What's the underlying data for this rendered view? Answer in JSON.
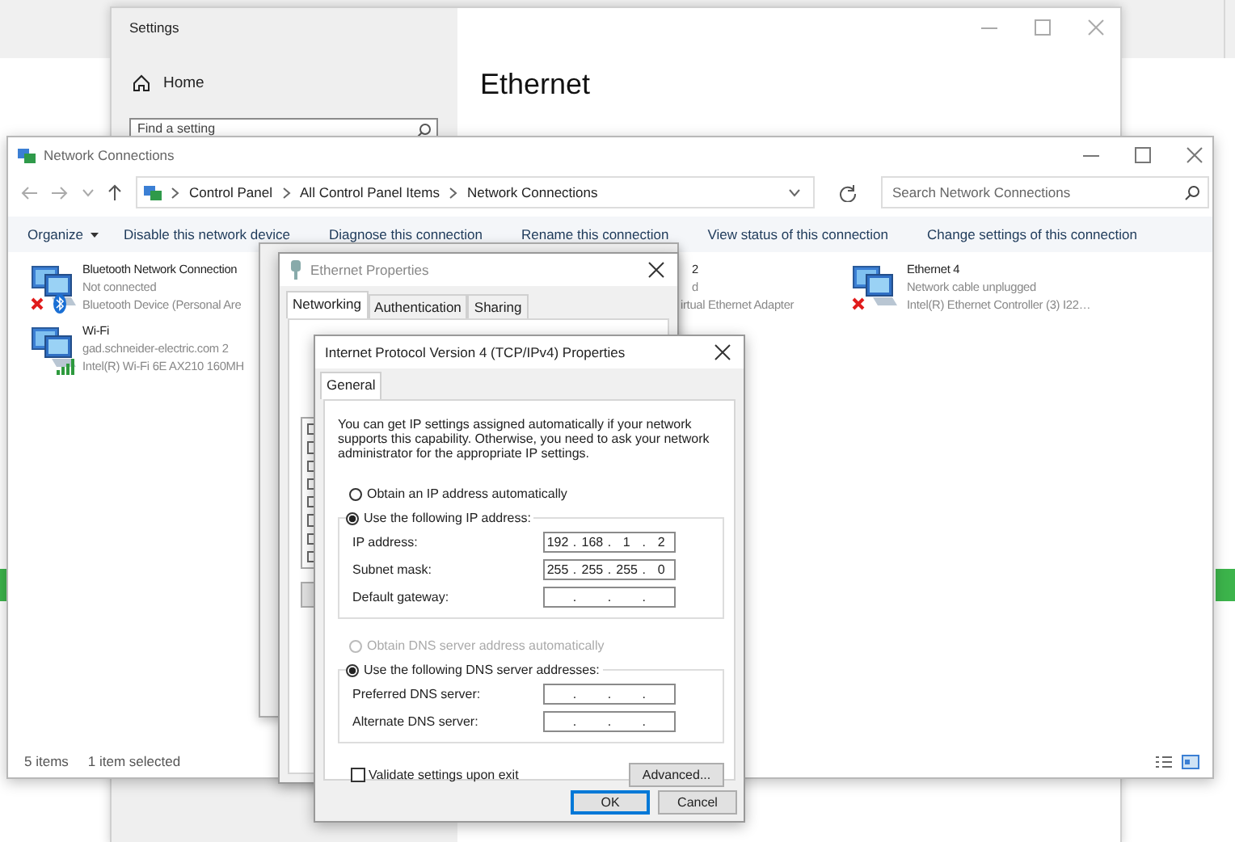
{
  "settings_window": {
    "title": "Settings",
    "home": "Home",
    "search": {
      "placeholder": "Find a setting"
    },
    "heading": "Ethernet"
  },
  "network_connections": {
    "title": "Network Connections",
    "breadcrumb": [
      "Control Panel",
      "All Control Panel Items",
      "Network Connections"
    ],
    "search": {
      "placeholder": "Search Network Connections"
    },
    "commands": [
      {
        "label": "Organize",
        "kind": "menu"
      },
      {
        "label": "Disable this network device",
        "kind": "action"
      },
      {
        "label": "Diagnose this connection",
        "kind": "action"
      },
      {
        "label": "Rename this connection",
        "kind": "action"
      },
      {
        "label": "View status of this connection",
        "kind": "action"
      },
      {
        "label": "Change settings of this connection",
        "kind": "action"
      }
    ],
    "items": [
      {
        "kind": "bluetooth",
        "name": "Bluetooth Network Connection",
        "status": "Not connected",
        "device": "Bluetooth Device (Personal Are",
        "disconnected": true
      },
      {
        "kind": "wifi",
        "name": "Wi-Fi",
        "status": "gad.schneider-electric.com 2",
        "device": "Intel(R) Wi-Fi 6E AX210 160MH",
        "disconnected": false
      },
      {
        "kind": "covered",
        "name": "2",
        "status": "d",
        "device": "irtual Ethernet Adapter"
      },
      {
        "kind": "ethernet",
        "name": "Ethernet 4",
        "status": "Network cable unplugged",
        "device": "Intel(R) Ethernet Controller (3) I22…",
        "disconnected": true
      }
    ],
    "status_bar": {
      "count": "5 items",
      "selection": "1 item selected"
    }
  },
  "ethernet_properties": {
    "title": "Ethernet Properties",
    "tabs": [
      {
        "label": "Networking",
        "selected": true
      },
      {
        "label": "Authentication",
        "selected": false
      },
      {
        "label": "Sharing",
        "selected": false
      }
    ]
  },
  "ipv4_dialog": {
    "title": "Internet Protocol Version 4 (TCP/IPv4) Properties",
    "tabs": [
      {
        "label": "General",
        "selected": true
      }
    ],
    "intro": "You can get IP settings assigned automatically if your network supports this capability. Otherwise, you need to ask your network administrator for the appropriate IP settings.",
    "separator": ".",
    "ip_mode": [
      {
        "label": "Obtain an IP address automatically",
        "selected": false,
        "disabled": false
      },
      {
        "label": "Use the following IP address:",
        "selected": true,
        "disabled": false
      }
    ],
    "ip_fields": [
      {
        "label": "IP address:",
        "octets": [
          "192",
          "168",
          "1",
          "2"
        ]
      },
      {
        "label": "Subnet mask:",
        "octets": [
          "255",
          "255",
          "255",
          "0"
        ]
      },
      {
        "label": "Default gateway:"
      }
    ],
    "dns_mode": [
      {
        "label": "Obtain DNS server address automatically",
        "selected": false,
        "disabled": true
      },
      {
        "label": "Use the following DNS server addresses:",
        "selected": true,
        "disabled": false
      }
    ],
    "dns_fields": [
      {
        "label": "Preferred DNS server:"
      },
      {
        "label": "Alternate DNS server:"
      }
    ],
    "validate": {
      "label": "Validate settings upon exit",
      "checked": false
    },
    "advanced": "Advanced...",
    "ok": "OK",
    "cancel": "Cancel"
  }
}
